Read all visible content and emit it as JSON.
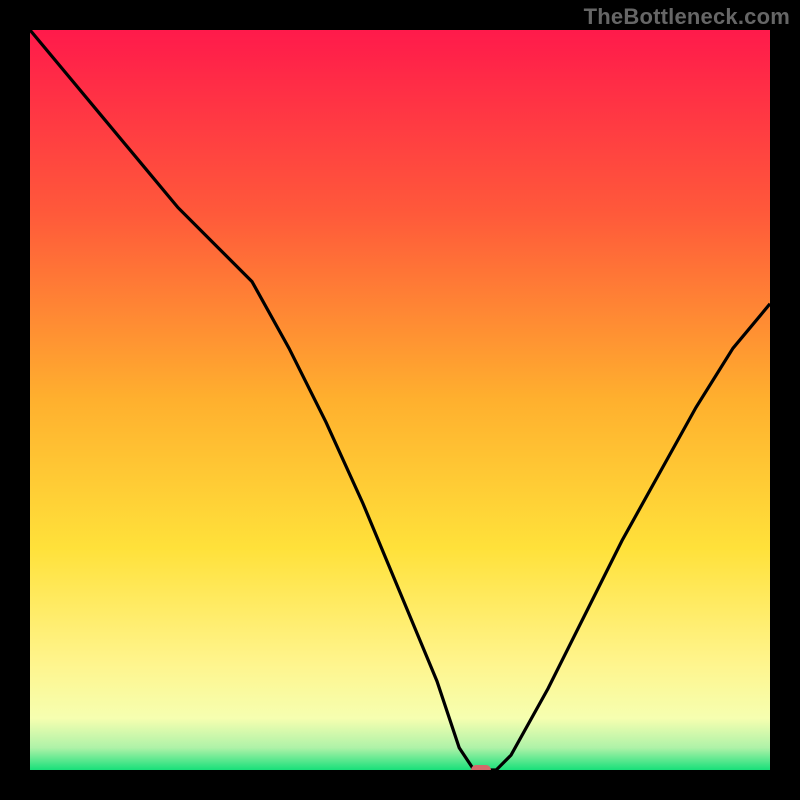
{
  "watermark": "TheBottleneck.com",
  "colors": {
    "frame": "#000000",
    "curve": "#000000",
    "marker": "#d46a6a"
  },
  "chart_data": {
    "type": "line",
    "title": "",
    "xlabel": "",
    "ylabel": "",
    "xlim": [
      0,
      100
    ],
    "ylim": [
      0,
      100
    ],
    "gradient_stops": [
      {
        "pos": 0,
        "color": "#ff1a4b"
      },
      {
        "pos": 25,
        "color": "#ff5a3a"
      },
      {
        "pos": 50,
        "color": "#ffb02e"
      },
      {
        "pos": 70,
        "color": "#ffe13a"
      },
      {
        "pos": 85,
        "color": "#fff48a"
      },
      {
        "pos": 93,
        "color": "#f6ffb0"
      },
      {
        "pos": 97,
        "color": "#aef2a8"
      },
      {
        "pos": 100,
        "color": "#18e07a"
      }
    ],
    "series": [
      {
        "name": "bottleneck-curve",
        "x": [
          0,
          5,
          10,
          15,
          20,
          25,
          30,
          35,
          40,
          45,
          50,
          55,
          58,
          60,
          62,
          63,
          65,
          70,
          75,
          80,
          85,
          90,
          95,
          100
        ],
        "y": [
          100,
          94,
          88,
          82,
          76,
          71,
          66,
          57,
          47,
          36,
          24,
          12,
          3,
          0,
          0,
          0,
          2,
          11,
          21,
          31,
          40,
          49,
          57,
          63
        ]
      }
    ],
    "marker": {
      "x": 61,
      "y": 0
    }
  }
}
